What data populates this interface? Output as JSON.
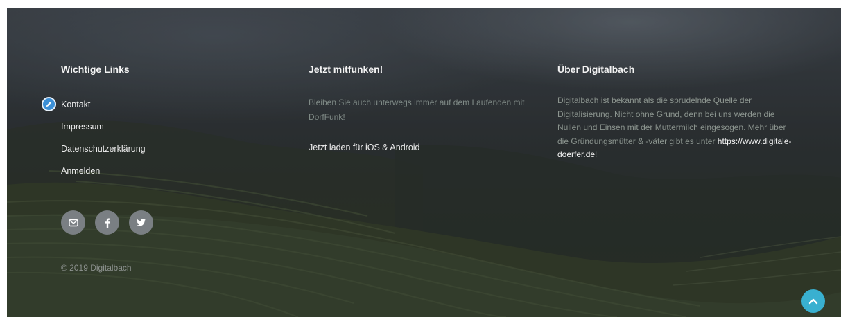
{
  "footer": {
    "links_section": {
      "heading": "Wichtige Links",
      "items": [
        {
          "label": "Kontakt"
        },
        {
          "label": "Impressum"
        },
        {
          "label": "Datenschutzerklärung"
        },
        {
          "label": "Anmelden"
        }
      ]
    },
    "app_section": {
      "heading": "Jetzt mitfunken!",
      "text": "Bleiben Sie auch unterwegs immer auf dem Laufenden mit DorfFunk!",
      "link_label": "Jetzt laden für iOS & Android"
    },
    "about_section": {
      "heading": "Über Digitalbach",
      "text": "Digitalbach ist bekannt als die sprudelnde Quelle der Digitalisierung. Nicht ohne Grund, denn bei uns werden die Nullen und Einsen mit der Muttermilch eingesogen. Mehr über die Gründungsmütter & -väter gibt es unter ",
      "link_label": "https://www.digitale-doerfer.de",
      "text_suffix": "!"
    },
    "social": [
      {
        "icon": "mail-icon"
      },
      {
        "icon": "facebook-icon"
      },
      {
        "icon": "twitter-icon"
      }
    ],
    "copyright": "© 2019 Digitalbach",
    "edit_badge_icon": "pencil-icon",
    "back_to_top_icon": "chevron-up-icon"
  },
  "colors": {
    "accent": "#39b0d0",
    "edit_badge": "#3b8fd6",
    "social_button": "#7a7f83"
  }
}
